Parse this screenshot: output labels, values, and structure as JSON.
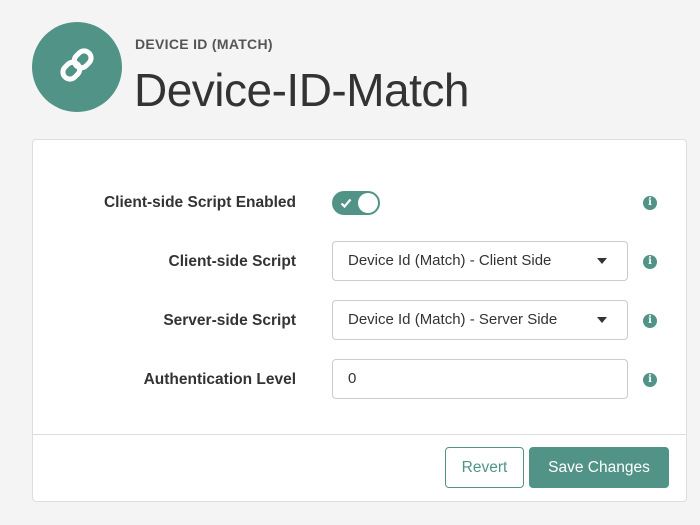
{
  "header": {
    "icon": "link-icon",
    "kicker": "DEVICE ID (MATCH)",
    "title": "Device-ID-Match"
  },
  "form": {
    "client_script_enabled": {
      "label": "Client-side Script Enabled",
      "value": true
    },
    "client_script": {
      "label": "Client-side Script",
      "value": "Device Id (Match) - Client Side"
    },
    "server_script": {
      "label": "Server-side Script",
      "value": "Device Id (Match) - Server Side"
    },
    "auth_level": {
      "label": "Authentication Level",
      "value": "0"
    },
    "info_icon": "i"
  },
  "footer": {
    "revert_label": "Revert",
    "save_label": "Save Changes"
  },
  "colors": {
    "accent": "#519387",
    "background": "#f4f4f4",
    "border": "#dddddd"
  }
}
